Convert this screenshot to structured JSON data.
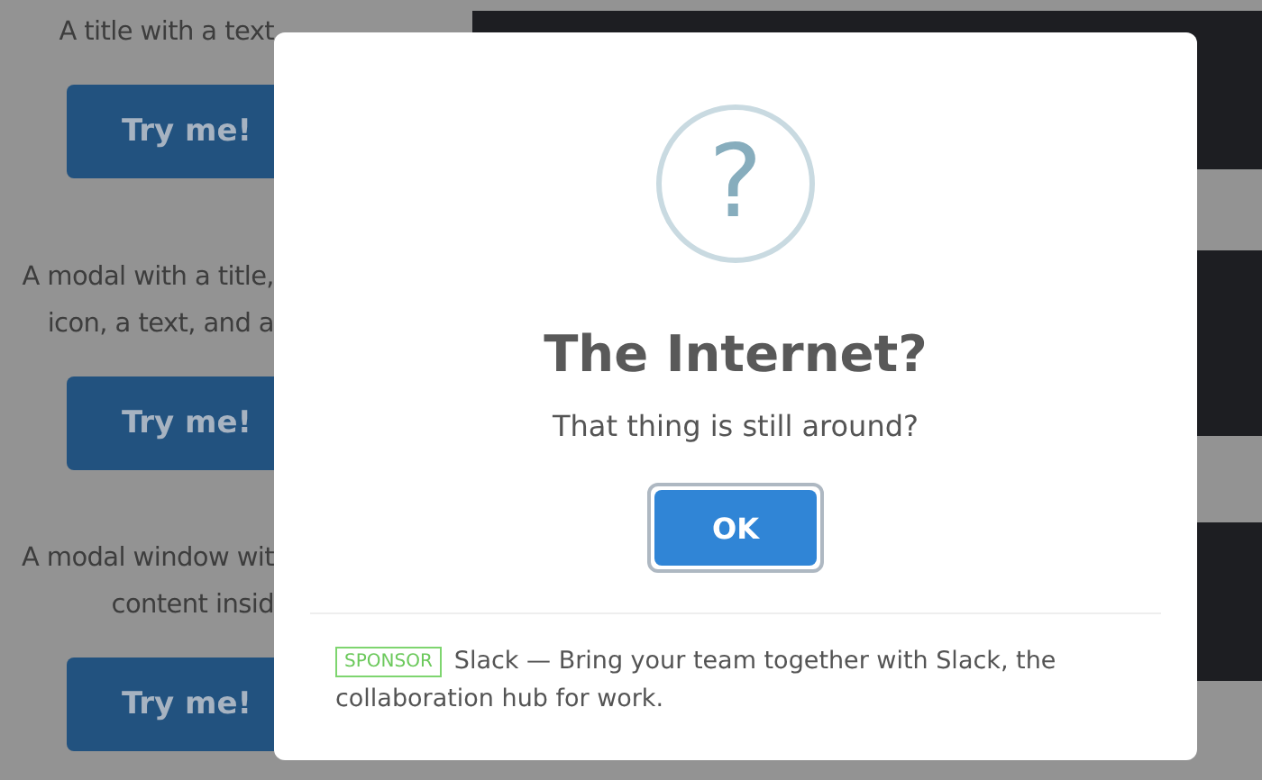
{
  "background": {
    "cards": [
      {
        "lines": [
          "A title with a text"
        ],
        "button": "Try me!"
      },
      {
        "lines": [
          "A modal with a title,",
          "icon, a text, and a"
        ],
        "button": "Try me!"
      },
      {
        "lines": [
          "A modal window wit",
          "content insid"
        ],
        "button": "Try me!"
      }
    ]
  },
  "modal": {
    "icon": "?",
    "title": "The Internet?",
    "text": "That thing is still around?",
    "button": "OK",
    "footer": {
      "badge": "SPONSOR",
      "lines": [
        "Slack — Bring your team together with Slack, the",
        "collaboration hub for work."
      ]
    }
  }
}
